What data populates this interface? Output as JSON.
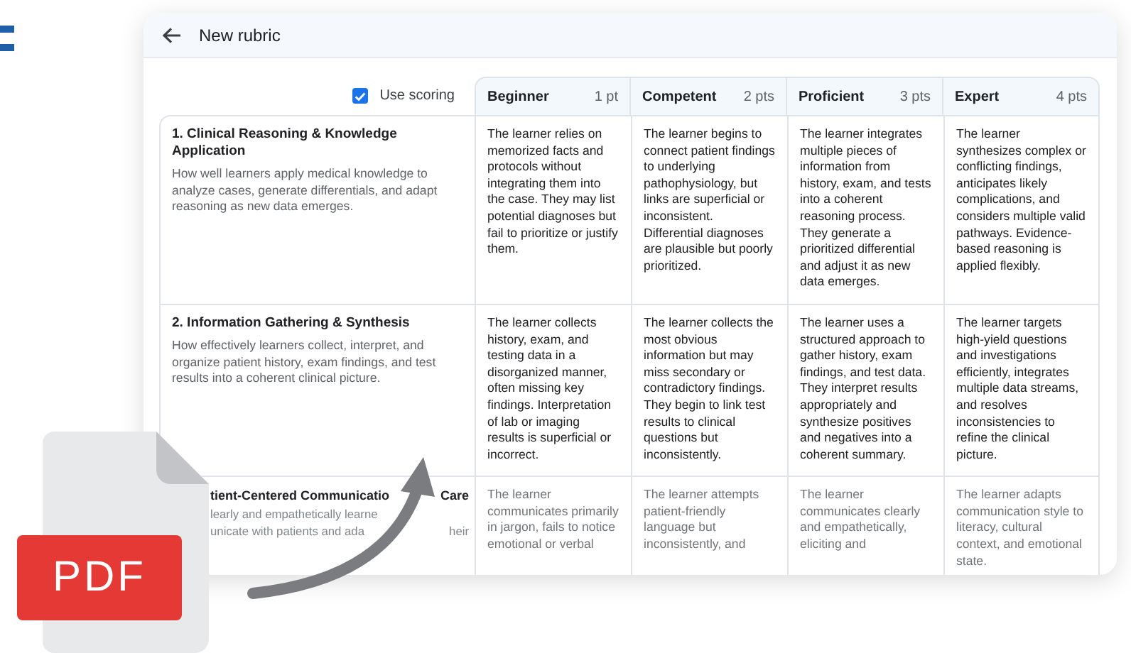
{
  "window": {
    "title": "New rubric"
  },
  "use_scoring": {
    "label": "Use scoring",
    "checked": true
  },
  "levels": [
    {
      "name": "Beginner",
      "points": "1 pt"
    },
    {
      "name": "Competent",
      "points": "2 pts"
    },
    {
      "name": "Proficient",
      "points": "3 pts"
    },
    {
      "name": "Expert",
      "points": "4 pts"
    }
  ],
  "criteria": [
    {
      "kind": "full",
      "title": "1. Clinical Reasoning & Knowledge Application",
      "description": "How well learners apply medical knowledge to analyze cases, generate differentials, and adapt reasoning as new data emerges.",
      "cells": [
        "The learner relies on memorized facts and protocols without integrating them into the case. They may list potential diagnoses but fail to prioritize or justify them.",
        "The learner begins to connect patient findings to underlying pathophysiology, but links are superficial or inconsistent. Differential diagnoses are plausible but poorly prioritized.",
        "The learner integrates multiple pieces of information from history, exam, and tests into a coherent reasoning process. They generate a prioritized differential and adjust it as new data emerges.",
        "The learner synthesizes complex or conflicting findings, anticipates likely complications, and considers multiple valid pathways. Evidence-based reasoning is applied flexibly."
      ]
    },
    {
      "kind": "full",
      "title": "2. Information Gathering & Synthesis",
      "description": "How effectively learners collect, interpret, and organize patient history, exam findings, and test results into a coherent clinical picture.",
      "cells": [
        "The learner collects history, exam, and testing data in a disorganized manner, often missing key findings. Interpretation of lab or imaging results is superficial or incorrect.",
        "The learner collects the most obvious information but may miss secondary or contradictory findings. They begin to link test results to clinical questions but inconsistently.",
        "The learner uses a structured approach to gather history, exam findings, and test data. They interpret results appropriately and synthesize positives and negatives into a coherent summary.",
        "The learner targets high-yield questions and investigations efficiently, integrates multiple data streams, and resolves inconsistencies to refine the clinical picture."
      ]
    },
    {
      "kind": "partial",
      "title_parts": [
        "tient-Centered Communicatio",
        "Care"
      ],
      "description_parts": [
        [
          "learly and empathetically learne"
        ],
        [
          "unicate with patients and ada",
          "heir"
        ]
      ],
      "cells": [
        "The learner communicates primarily in jargon, fails to notice emotional or verbal",
        "The learner attempts patient-friendly language but inconsistently, and",
        "The learner communicates clearly and empathetically, eliciting and",
        "The learner adapts communication style to literacy, cultural context, and emotional state."
      ]
    }
  ],
  "file_badge": "PDF"
}
